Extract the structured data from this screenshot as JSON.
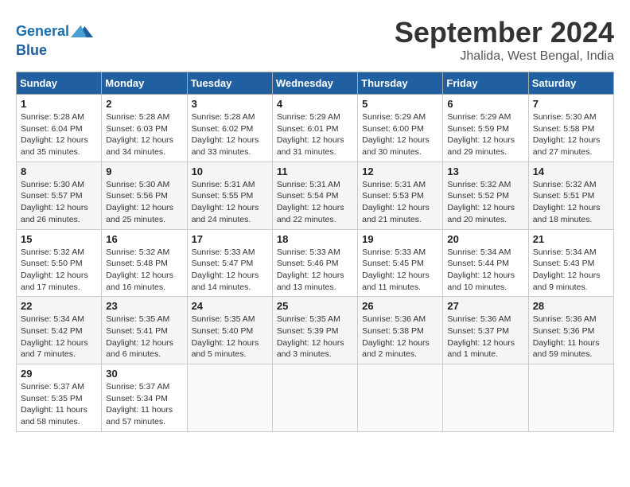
{
  "header": {
    "logo_line1": "General",
    "logo_line2": "Blue",
    "month": "September 2024",
    "location": "Jhalida, West Bengal, India"
  },
  "weekdays": [
    "Sunday",
    "Monday",
    "Tuesday",
    "Wednesday",
    "Thursday",
    "Friday",
    "Saturday"
  ],
  "weeks": [
    [
      {
        "day": "1",
        "info": "Sunrise: 5:28 AM\nSunset: 6:04 PM\nDaylight: 12 hours\nand 35 minutes."
      },
      {
        "day": "2",
        "info": "Sunrise: 5:28 AM\nSunset: 6:03 PM\nDaylight: 12 hours\nand 34 minutes."
      },
      {
        "day": "3",
        "info": "Sunrise: 5:28 AM\nSunset: 6:02 PM\nDaylight: 12 hours\nand 33 minutes."
      },
      {
        "day": "4",
        "info": "Sunrise: 5:29 AM\nSunset: 6:01 PM\nDaylight: 12 hours\nand 31 minutes."
      },
      {
        "day": "5",
        "info": "Sunrise: 5:29 AM\nSunset: 6:00 PM\nDaylight: 12 hours\nand 30 minutes."
      },
      {
        "day": "6",
        "info": "Sunrise: 5:29 AM\nSunset: 5:59 PM\nDaylight: 12 hours\nand 29 minutes."
      },
      {
        "day": "7",
        "info": "Sunrise: 5:30 AM\nSunset: 5:58 PM\nDaylight: 12 hours\nand 27 minutes."
      }
    ],
    [
      {
        "day": "8",
        "info": "Sunrise: 5:30 AM\nSunset: 5:57 PM\nDaylight: 12 hours\nand 26 minutes."
      },
      {
        "day": "9",
        "info": "Sunrise: 5:30 AM\nSunset: 5:56 PM\nDaylight: 12 hours\nand 25 minutes."
      },
      {
        "day": "10",
        "info": "Sunrise: 5:31 AM\nSunset: 5:55 PM\nDaylight: 12 hours\nand 24 minutes."
      },
      {
        "day": "11",
        "info": "Sunrise: 5:31 AM\nSunset: 5:54 PM\nDaylight: 12 hours\nand 22 minutes."
      },
      {
        "day": "12",
        "info": "Sunrise: 5:31 AM\nSunset: 5:53 PM\nDaylight: 12 hours\nand 21 minutes."
      },
      {
        "day": "13",
        "info": "Sunrise: 5:32 AM\nSunset: 5:52 PM\nDaylight: 12 hours\nand 20 minutes."
      },
      {
        "day": "14",
        "info": "Sunrise: 5:32 AM\nSunset: 5:51 PM\nDaylight: 12 hours\nand 18 minutes."
      }
    ],
    [
      {
        "day": "15",
        "info": "Sunrise: 5:32 AM\nSunset: 5:50 PM\nDaylight: 12 hours\nand 17 minutes."
      },
      {
        "day": "16",
        "info": "Sunrise: 5:32 AM\nSunset: 5:48 PM\nDaylight: 12 hours\nand 16 minutes."
      },
      {
        "day": "17",
        "info": "Sunrise: 5:33 AM\nSunset: 5:47 PM\nDaylight: 12 hours\nand 14 minutes."
      },
      {
        "day": "18",
        "info": "Sunrise: 5:33 AM\nSunset: 5:46 PM\nDaylight: 12 hours\nand 13 minutes."
      },
      {
        "day": "19",
        "info": "Sunrise: 5:33 AM\nSunset: 5:45 PM\nDaylight: 12 hours\nand 11 minutes."
      },
      {
        "day": "20",
        "info": "Sunrise: 5:34 AM\nSunset: 5:44 PM\nDaylight: 12 hours\nand 10 minutes."
      },
      {
        "day": "21",
        "info": "Sunrise: 5:34 AM\nSunset: 5:43 PM\nDaylight: 12 hours\nand 9 minutes."
      }
    ],
    [
      {
        "day": "22",
        "info": "Sunrise: 5:34 AM\nSunset: 5:42 PM\nDaylight: 12 hours\nand 7 minutes."
      },
      {
        "day": "23",
        "info": "Sunrise: 5:35 AM\nSunset: 5:41 PM\nDaylight: 12 hours\nand 6 minutes."
      },
      {
        "day": "24",
        "info": "Sunrise: 5:35 AM\nSunset: 5:40 PM\nDaylight: 12 hours\nand 5 minutes."
      },
      {
        "day": "25",
        "info": "Sunrise: 5:35 AM\nSunset: 5:39 PM\nDaylight: 12 hours\nand 3 minutes."
      },
      {
        "day": "26",
        "info": "Sunrise: 5:36 AM\nSunset: 5:38 PM\nDaylight: 12 hours\nand 2 minutes."
      },
      {
        "day": "27",
        "info": "Sunrise: 5:36 AM\nSunset: 5:37 PM\nDaylight: 12 hours\nand 1 minute."
      },
      {
        "day": "28",
        "info": "Sunrise: 5:36 AM\nSunset: 5:36 PM\nDaylight: 11 hours\nand 59 minutes."
      }
    ],
    [
      {
        "day": "29",
        "info": "Sunrise: 5:37 AM\nSunset: 5:35 PM\nDaylight: 11 hours\nand 58 minutes."
      },
      {
        "day": "30",
        "info": "Sunrise: 5:37 AM\nSunset: 5:34 PM\nDaylight: 11 hours\nand 57 minutes."
      },
      {
        "day": "",
        "info": ""
      },
      {
        "day": "",
        "info": ""
      },
      {
        "day": "",
        "info": ""
      },
      {
        "day": "",
        "info": ""
      },
      {
        "day": "",
        "info": ""
      }
    ]
  ]
}
